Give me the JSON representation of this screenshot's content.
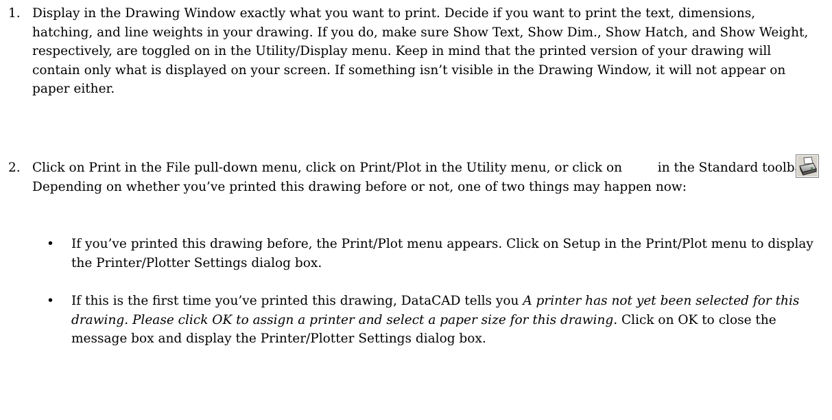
{
  "steps": [
    {
      "number": "1.",
      "text": "Display in the Drawing Window exactly what you want to print. Decide if you want to print the text, dimensions, hatching, and line weights in your drawing. If you do, make sure Show Text, Show Dim., Show Hatch, and Show Weight, respectively, are toggled on in the Utility/Display menu. Keep in mind that the printed version of your drawing will contain only what is displayed on your screen. If something isn’t visible in the Drawing Window, it will not appear on paper either."
    },
    {
      "number": "2.",
      "text_before_icon": "Click on Print in the File pull-down menu, click on Print/Plot in the Utility menu, or click on",
      "text_after_icon": "in the Standard toolbar. Depending on whether you’ve printed this drawing before or not, one of two things may happen now:",
      "icon": "printer-icon",
      "bullets": [
        {
          "text": "If you’ve printed this drawing before, the Print/Plot menu appears. Click on Setup in the Print/Plot menu to display the Printer/Plotter Settings dialog box."
        },
        {
          "text_plain_start": "If this is the first time you’ve printed this drawing, DataCAD tells you ",
          "text_italic": "A printer has not yet been selected for this drawing. Please click OK to assign a printer and select a paper size for this drawing",
          "text_plain_end": ". Click on OK to close the message box and display the Printer/Plotter Settings dialog box."
        }
      ]
    }
  ],
  "bullet_glyph": "•"
}
